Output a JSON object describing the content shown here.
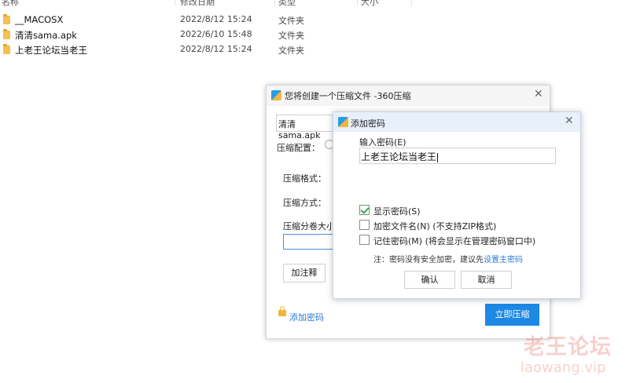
{
  "explorer": {
    "columns": [
      "名称",
      "修改日期",
      "类型",
      "大小"
    ],
    "files": [
      {
        "name": "__MACOSX",
        "date": "2022/8/12 15:24",
        "type": "文件夹"
      },
      {
        "name": "清清sama.apk",
        "date": "2022/6/10 15:48",
        "type": "文件夹"
      },
      {
        "name": "上老王论坛当老王",
        "date": "2022/8/12 15:24",
        "type": "文件夹"
      }
    ]
  },
  "compress_window": {
    "title": "您将创建一个压缩文件 -360压缩",
    "filename": "清清sama.apk",
    "config_label": "压缩配置：",
    "format_label": "压缩格式：",
    "method_label": "压缩方式：",
    "volume_label": "压缩分卷大小：",
    "comment_button": "加注释",
    "add_password_link": "添加密码",
    "compress_button": "立即压缩"
  },
  "password_dialog": {
    "title": "添加密码",
    "input_label": "输入密码(E)",
    "password_value": "上老王论坛当老王",
    "options": [
      {
        "label": "显示密码(S)",
        "checked": true
      },
      {
        "label": "加密文件名(N) (不支持ZIP格式)",
        "checked": false
      },
      {
        "label": "记住密码(M) (将会显示在管理密码窗口中)",
        "checked": false
      }
    ],
    "note_prefix": "注：密码没有安全加密，建议先",
    "note_link": "设置主密码",
    "ok_button": "确认",
    "cancel_button": "取消"
  },
  "watermark": {
    "line1": "老王论坛",
    "line2": "laowang.vip"
  }
}
